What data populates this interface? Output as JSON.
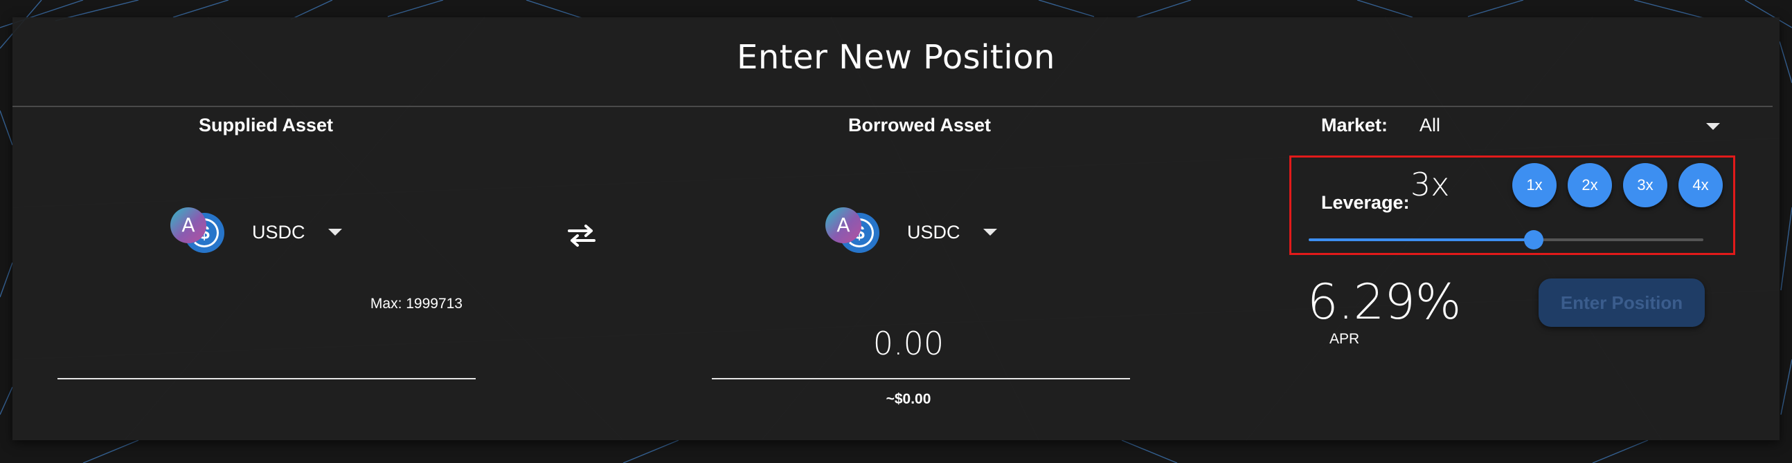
{
  "header": {
    "title": "Enter New Position"
  },
  "supplied": {
    "heading": "Supplied Asset",
    "asset": "USDC",
    "icon": "usdc-aave-token-icon",
    "max_label": "Max: 1999713"
  },
  "swap": {
    "icon": "swap-arrows-icon"
  },
  "borrowed": {
    "heading": "Borrowed Asset",
    "asset": "USDC",
    "icon": "usdc-aave-token-icon",
    "amount": "0.00",
    "usd_value": "~$0.00"
  },
  "market": {
    "label": "Market:",
    "value": "All"
  },
  "leverage": {
    "label": "Leverage:",
    "value": "3x",
    "options": [
      "1x",
      "2x",
      "3x",
      "4x"
    ],
    "slider_fraction": 0.57
  },
  "apr": {
    "value": "6.29%",
    "label": "APR"
  },
  "actions": {
    "enter_label": "Enter Position"
  },
  "colors": {
    "accent": "#3d8ff1",
    "highlight": "#e11a1a",
    "panel": "#202020",
    "disabled_button": "#1f3d66"
  }
}
